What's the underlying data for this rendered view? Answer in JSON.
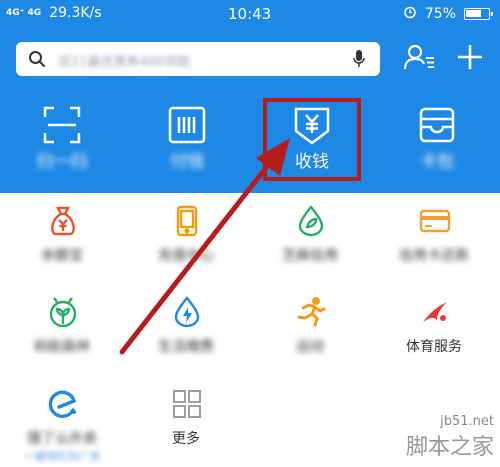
{
  "status_bar": {
    "network": "4G⁺ 4G",
    "speed": "29.3K/s",
    "time": "10:43",
    "battery_text": "75%",
    "battery_level": 0.75
  },
  "header": {
    "search_placeholder": "双11最优惠券400领取",
    "contacts_icon": "contacts-icon",
    "add_icon": "plus-icon"
  },
  "quick_actions": [
    {
      "label": "扫一扫",
      "icon": "scan-icon"
    },
    {
      "label": "付钱",
      "icon": "barcode-icon"
    },
    {
      "label": "收钱",
      "icon": "yuan-receive-icon"
    },
    {
      "label": "卡包",
      "icon": "wallet-card-icon"
    }
  ],
  "apps": [
    {
      "label": "余额宝",
      "icon": "money-bag-icon",
      "color": "#e8542f"
    },
    {
      "label": "充值中心",
      "icon": "phone-icon",
      "color": "#f39c12"
    },
    {
      "label": "芝麻信用",
      "icon": "leaf-drop-icon",
      "color": "#27ae60"
    },
    {
      "label": "信用卡还款",
      "icon": "credit-card-icon",
      "color": "#f0a030"
    },
    {
      "label": "蚂蚁森林",
      "icon": "bug-sprout-icon",
      "color": "#27ae60"
    },
    {
      "label": "生活缴费",
      "icon": "drop-bolt-icon",
      "color": "#1e88e5"
    },
    {
      "label": "运动",
      "icon": "runner-icon",
      "color": "#f39c12"
    },
    {
      "label": "体育服务",
      "icon": "sports-icon",
      "color": "#e53935"
    },
    {
      "label": "饿了么外卖",
      "sub": "一键领红包广告",
      "icon": "eleme-icon",
      "color": "#1e88e5"
    },
    {
      "label": "更多",
      "icon": "grid-more-icon",
      "color": "#9e9e9e"
    }
  ],
  "watermark": {
    "site": "jb51.net",
    "name": "脚本之家"
  },
  "colors": {
    "header_blue": "#1e88e5",
    "highlight_red": "#b71c1c"
  }
}
